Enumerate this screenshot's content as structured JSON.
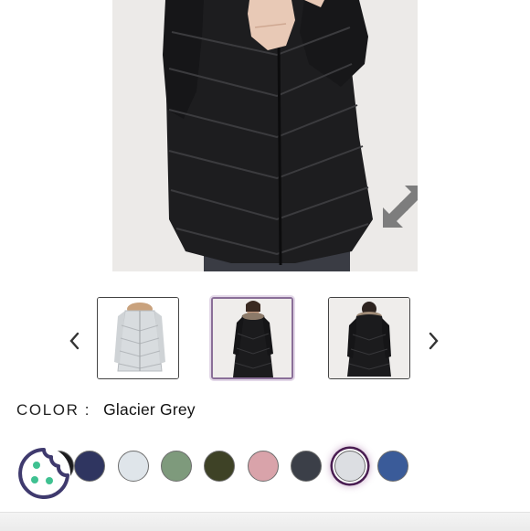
{
  "product_gallery": {
    "main_image_icon": "woman-in-black-puffer-coat",
    "expand_icon": "expand-arrows-icon",
    "prev_icon": "chevron-left-icon",
    "next_icon": "chevron-right-icon",
    "thumbnails": [
      {
        "icon": "grey-coat-product-photo",
        "selected": false
      },
      {
        "icon": "black-coat-model-front-photo",
        "selected": true
      },
      {
        "icon": "black-coat-model-back-photo",
        "selected": false
      }
    ]
  },
  "color_selector": {
    "label": "COLOR :",
    "selected_value": "Glacier Grey",
    "swatches": [
      {
        "color": "#1c1c1e",
        "selected": false
      },
      {
        "color": "#2f3560",
        "selected": false
      },
      {
        "color": "#dfe5ea",
        "selected": false
      },
      {
        "color": "#7e9a7c",
        "selected": false
      },
      {
        "color": "#3e4226",
        "selected": false
      },
      {
        "color": "#d9a3aa",
        "selected": false
      },
      {
        "color": "#3b3f48",
        "selected": false
      },
      {
        "color": "#dcdee2",
        "selected": true
      },
      {
        "color": "#3a5b99",
        "selected": false
      }
    ]
  },
  "cookie_badge": {
    "icon": "cookie-icon",
    "color": "#3f3a6e",
    "dots_color": "#3fc191"
  }
}
